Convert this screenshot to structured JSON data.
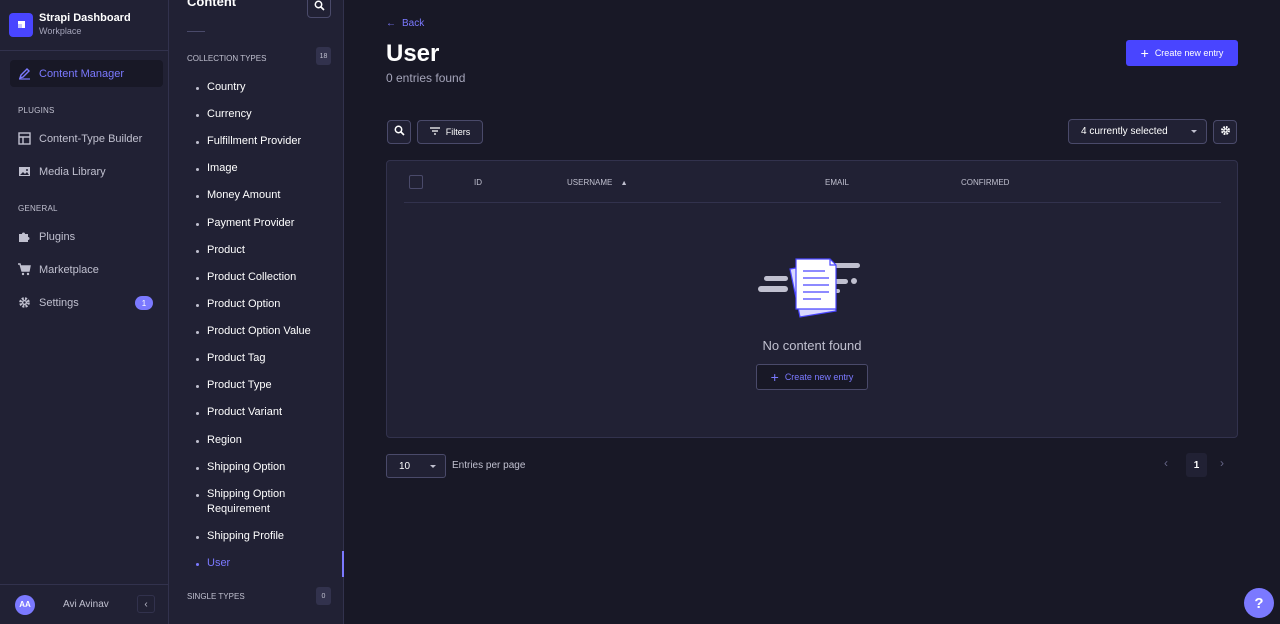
{
  "brand": {
    "name": "Strapi Dashboard",
    "workspace": "Workplace"
  },
  "nav": {
    "content_manager": "Content Manager",
    "plugins_section": "PLUGINS",
    "content_type_builder": "Content-Type Builder",
    "media_library": "Media Library",
    "general_section": "GENERAL",
    "plugins": "Plugins",
    "marketplace": "Marketplace",
    "settings": "Settings",
    "settings_badge": "1"
  },
  "user": {
    "initials": "AA",
    "name": "Avi Avinav"
  },
  "subnav": {
    "title": "Content",
    "collection_types_label": "COLLECTION TYPES",
    "collection_types_count": "18",
    "single_types_label": "SINGLE TYPES",
    "single_types_count": "0",
    "items": [
      "Country",
      "Currency",
      "Fulfillment Provider",
      "Image",
      "Money Amount",
      "Payment Provider",
      "Product",
      "Product Collection",
      "Product Option",
      "Product Option Value",
      "Product Tag",
      "Product Type",
      "Product Variant",
      "Region",
      "Shipping Option",
      "Shipping Option Requirement",
      "Shipping Profile",
      "User"
    ]
  },
  "header": {
    "back": "Back",
    "title": "User",
    "subtitle": "0 entries found",
    "create_button": "Create new entry"
  },
  "toolbar": {
    "filters": "Filters",
    "columns_select": "4 currently selected"
  },
  "table": {
    "columns": [
      "ID",
      "USERNAME",
      "EMAIL",
      "CONFIRMED"
    ],
    "empty_text": "No content found",
    "empty_button": "Create new entry"
  },
  "pagination": {
    "per_page": "10",
    "per_page_label": "Entries per page",
    "current_page": "1"
  },
  "help": "?"
}
